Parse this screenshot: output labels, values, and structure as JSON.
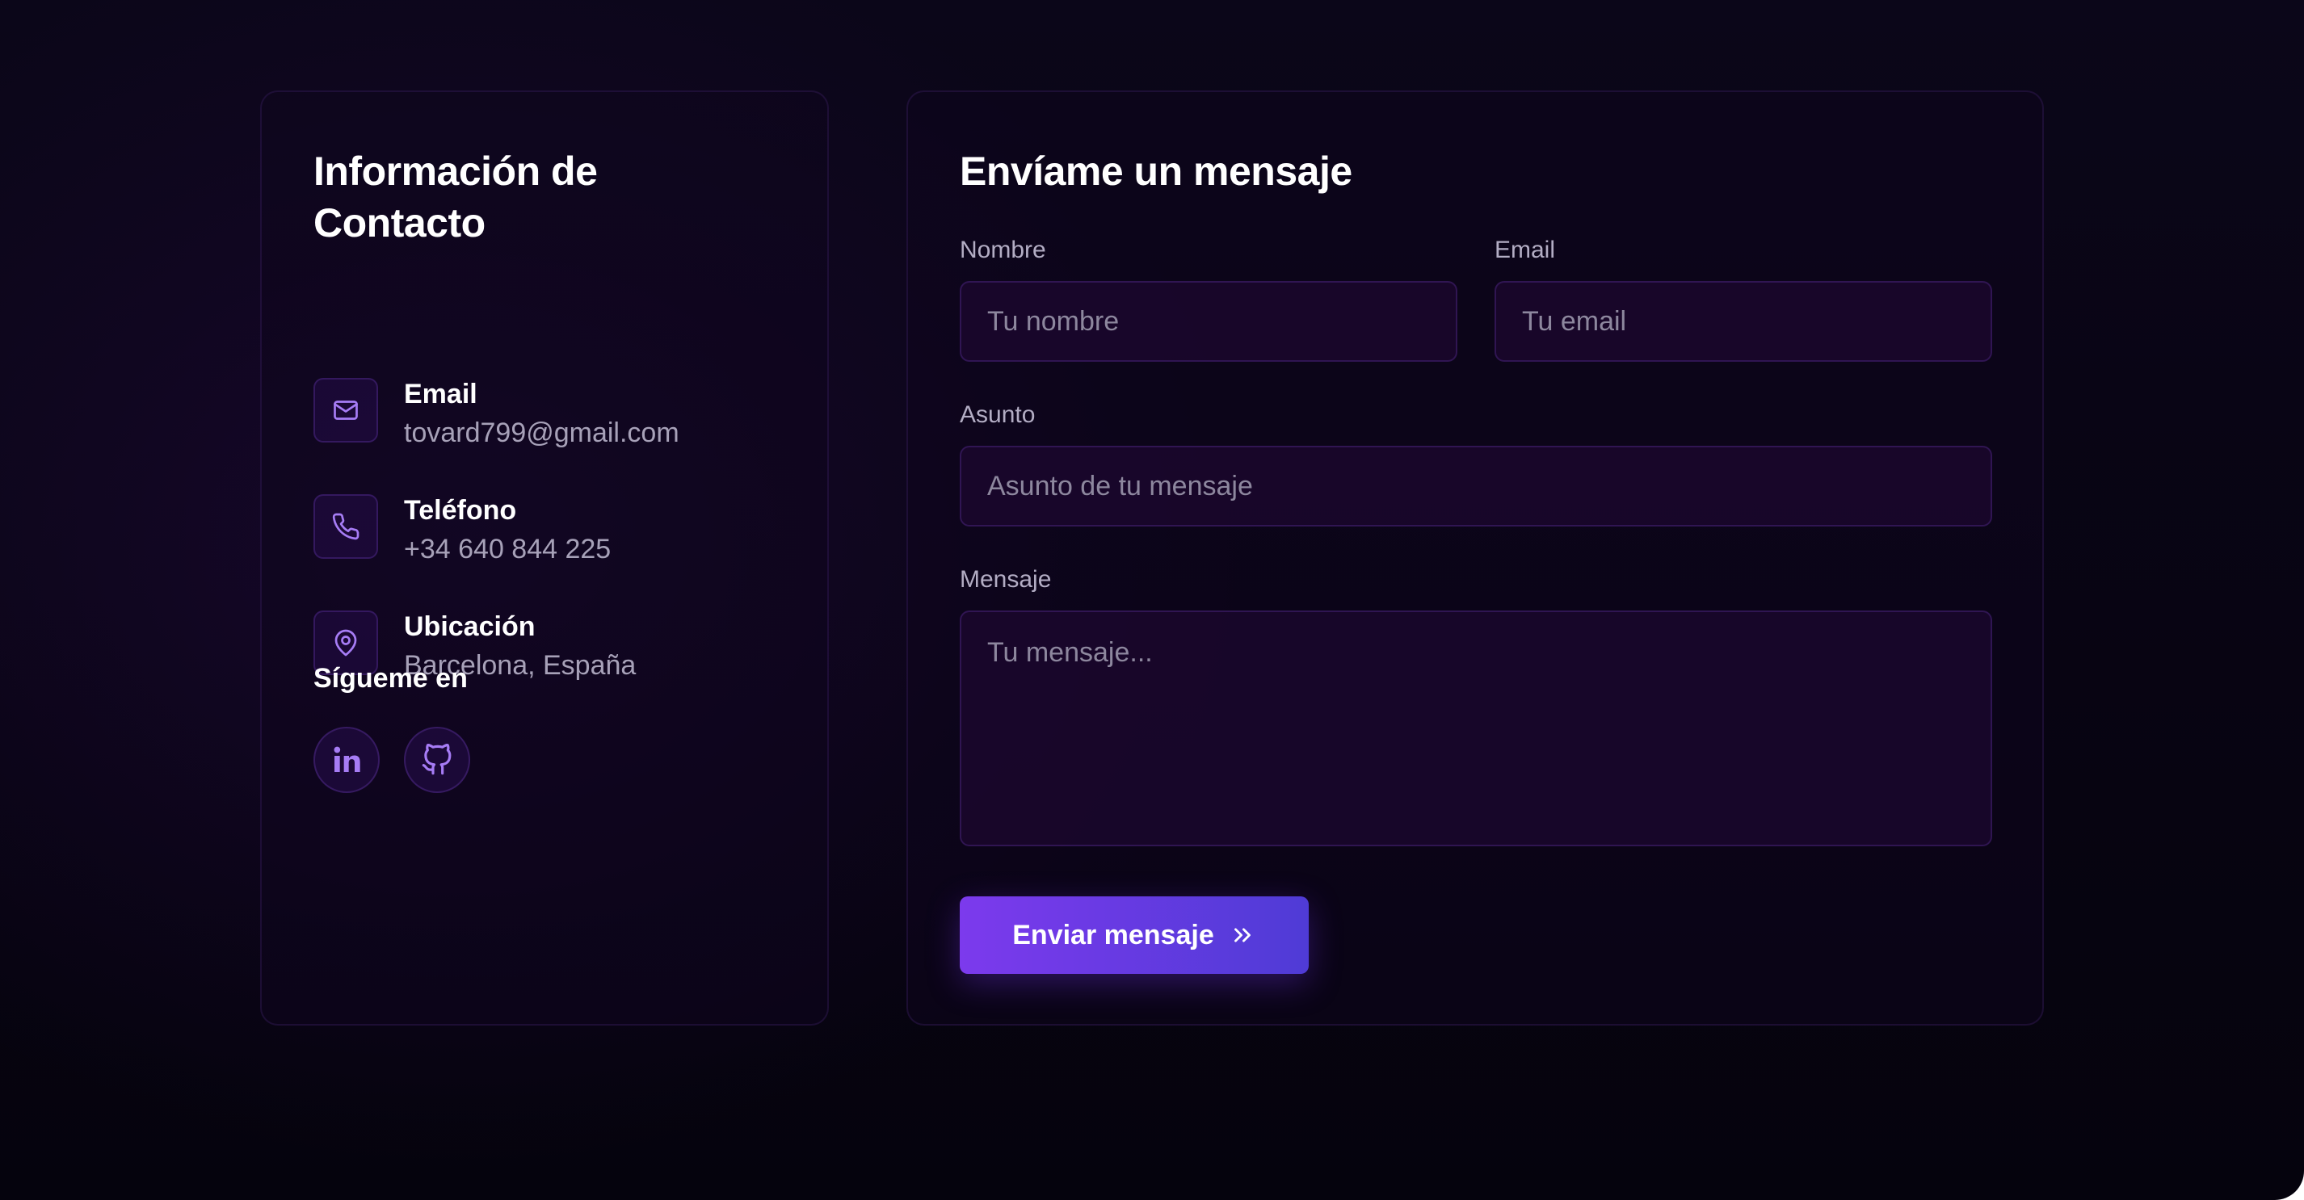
{
  "contact_info": {
    "title": "Información de Contacto",
    "items": [
      {
        "icon": "mail-icon",
        "label": "Email",
        "value": "tovard799@gmail.com"
      },
      {
        "icon": "phone-icon",
        "label": "Teléfono",
        "value": "+34 640 844 225"
      },
      {
        "icon": "map-pin-icon",
        "label": "Ubicación",
        "value": "Barcelona, España"
      }
    ],
    "follow_title": "Sígueme en",
    "social": [
      {
        "icon": "linkedin-icon"
      },
      {
        "icon": "github-icon"
      }
    ]
  },
  "form": {
    "title": "Envíame un mensaje",
    "name": {
      "label": "Nombre",
      "placeholder": "Tu nombre"
    },
    "email": {
      "label": "Email",
      "placeholder": "Tu email"
    },
    "subject": {
      "label": "Asunto",
      "placeholder": "Asunto de tu mensaje"
    },
    "message": {
      "label": "Mensaje",
      "placeholder": "Tu mensaje..."
    },
    "submit_label": "Enviar mensaje",
    "submit_icon": "chevrons-right-icon"
  },
  "colors": {
    "accent": "#7c3aed",
    "accent_end": "#4f3bd6",
    "icon": "#a67cf5",
    "background": "#07040f"
  }
}
